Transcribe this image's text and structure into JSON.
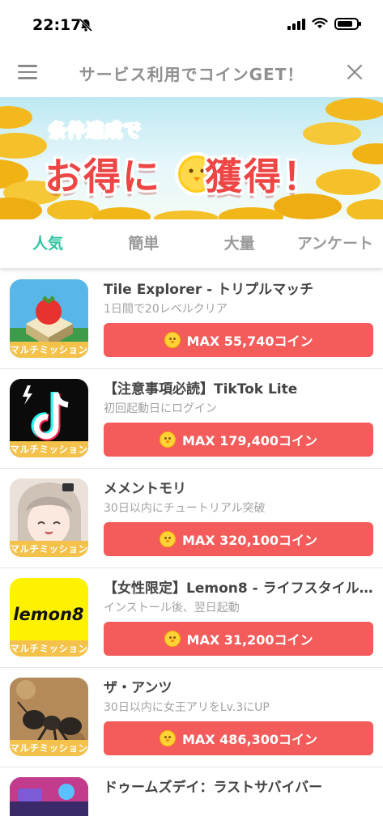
{
  "status_bar": {
    "time": "22:17"
  },
  "header": {
    "title": "サービス利用でコインGET！"
  },
  "banner": {
    "line1": "条件達成で",
    "line2_a": "お得に",
    "line2_b": "獲得！"
  },
  "tabs": [
    {
      "label": "人気",
      "active": true
    },
    {
      "label": "簡単",
      "active": false
    },
    {
      "label": "大量",
      "active": false
    },
    {
      "label": "アンケート",
      "active": false
    }
  ],
  "badge_label": "マルチミッション",
  "offers": [
    {
      "title": "Tile Explorer - トリプルマッチ",
      "subtitle": "1日間で20レベルクリア",
      "reward": "MAX 55,740コイン"
    },
    {
      "title": "【注意事項必読】TikTok Lite",
      "subtitle": "初回起動日にログイン",
      "reward": "MAX 179,400コイン"
    },
    {
      "title": "メメントモリ",
      "subtitle": "30日以内にチュートリアル突破",
      "reward": "MAX 320,100コイン"
    },
    {
      "title": "【女性限定】Lemon8 - ライフスタイル…",
      "subtitle": "インストール後、翌日起動",
      "reward": "MAX 31,200コイン"
    },
    {
      "title": "ザ・アンツ",
      "subtitle": "30日以内に女王アリをLv.3にUP",
      "reward": "MAX 486,300コイン"
    },
    {
      "title": "ドゥームズデイ：ラストサバイバー"
    }
  ],
  "icons": {
    "lemon8_logo_text": "lemon8"
  }
}
